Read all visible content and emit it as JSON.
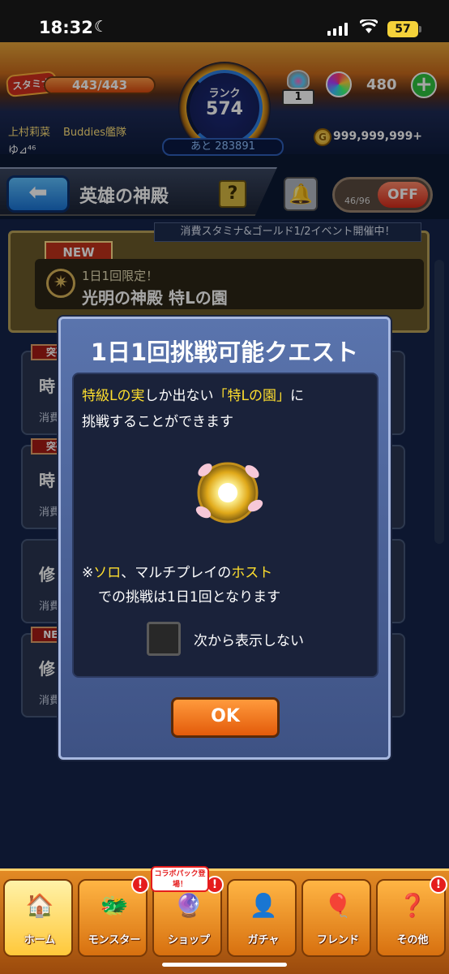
{
  "status_bar": {
    "time": "18:32",
    "battery": "57"
  },
  "hud": {
    "stamina_label": "スタミナ",
    "stamina_value": "443/443",
    "stamina_fraction": 1.0,
    "rank_label": "ランク",
    "rank_value": "574",
    "rank_next": "あと 283891",
    "booster_count": "1",
    "orb_count": "480",
    "player_name": "上村莉菜",
    "player_team": "Buddies艦隊",
    "player_level": "ゆ⊿⁴⁶",
    "gold": "999,999,999+",
    "colors": {
      "orb_plus": "#2ec43f",
      "stamina": "#d84a0e",
      "gold": "#d89a0f"
    }
  },
  "subheader": {
    "title": "英雄の神殿",
    "help_label": "?",
    "toggle_counter": "46/96",
    "toggle_label": "OFF"
  },
  "list": {
    "event_banner": "消費スタミナ&ゴールド1/2イベント開催中！",
    "featured": {
      "tag": "NEW",
      "subtitle": "1日1回限定！",
      "title": "光明の神殿 特Lの園"
    },
    "rows": [
      {
        "tag": "突破",
        "text": "時",
        "sub": "消費"
      },
      {
        "tag": "突破",
        "text": "時",
        "sub": "消費"
      },
      {
        "tag": "",
        "text": "修",
        "sub": "消費"
      },
      {
        "tag": "NEW",
        "text": "修",
        "sub": "消費"
      }
    ]
  },
  "modal": {
    "title": "1日1回挑戦可能クエスト",
    "message_line1_a": "特級Lの実",
    "message_line1_b": "しか出ない",
    "message_line1_c": "「特Lの園」",
    "message_line1_d": "に",
    "message_line2": "挑戦することができます",
    "note_prefix": "※",
    "note_solo": "ソロ",
    "note_mid": "、マルチプレイの",
    "note_host": "ホスト",
    "note_line2": "での挑戦は1日1回となります",
    "checkbox_label": "次から表示しない",
    "checkbox_checked": false,
    "ok_label": "OK",
    "colors": {
      "highlight": "#ffdf2e",
      "ok_button": "#e35b0a"
    }
  },
  "bottom_nav": {
    "collab_tag": "コラボパック登場！",
    "tabs": [
      {
        "label": "ホーム",
        "icon": "home-icon",
        "badge": ""
      },
      {
        "label": "モンスター",
        "icon": "monster-icon",
        "badge": "!"
      },
      {
        "label": "ショップ",
        "icon": "shop-icon",
        "badge": "!"
      },
      {
        "label": "ガチャ",
        "icon": "gacha-icon",
        "badge": ""
      },
      {
        "label": "フレンド",
        "icon": "friend-icon",
        "badge": ""
      },
      {
        "label": "その他",
        "icon": "other-icon",
        "badge": "!"
      }
    ]
  }
}
